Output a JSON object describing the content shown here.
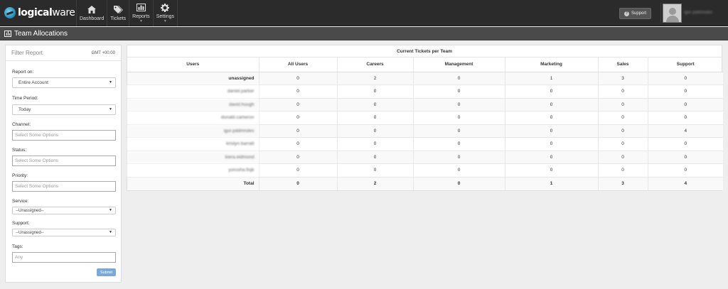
{
  "brand": {
    "logo_bold": "logical",
    "logo_light": "ware"
  },
  "nav": [
    {
      "label": "Dashboard",
      "icon": "home-icon"
    },
    {
      "label": "Tickets",
      "icon": "tags-icon"
    },
    {
      "label": "Reports",
      "icon": "bar-chart-icon",
      "caret": "▼"
    },
    {
      "label": "Settings",
      "icon": "gear-icon",
      "caret": "▼"
    }
  ],
  "header": {
    "support_label": "Support",
    "user_name": "Igor pddmndes"
  },
  "page": {
    "title": "Team Allocations"
  },
  "filter": {
    "title": "Filter Report",
    "timezone": "GMT +00:00",
    "report_on_label": "Report on:",
    "report_on_value": "Entire Account",
    "time_period_label": "Time Period:",
    "time_period_value": "Today",
    "channel_label": "Channel:",
    "channel_placeholder": "Select Some Options",
    "status_label": "Status:",
    "status_placeholder": "Select Some Options",
    "priority_label": "Priority:",
    "priority_placeholder": "Select Some Options",
    "service_label": "Service:",
    "service_value": "--Unassigned--",
    "support_label": "Support:",
    "support_value": "--Unassigned--",
    "tags_label": "Tags:",
    "tags_placeholder": "Any",
    "submit_label": "Submit"
  },
  "report": {
    "title": "Current Tickets per Team",
    "columns": [
      "Users",
      "All Users",
      "Careers",
      "Management",
      "Marketing",
      "Sales",
      "Support"
    ],
    "rows": [
      {
        "user": "unassigned",
        "values": [
          "0",
          "2",
          "0",
          "1",
          "3",
          "0"
        ]
      },
      {
        "user": "daniel.parker",
        "values": [
          "0",
          "0",
          "0",
          "0",
          "0",
          "0"
        ]
      },
      {
        "user": "david.hough",
        "values": [
          "0",
          "0",
          "0",
          "0",
          "0",
          "0"
        ]
      },
      {
        "user": "donald.cameron",
        "values": [
          "0",
          "0",
          "0",
          "0",
          "0",
          "0"
        ]
      },
      {
        "user": "igor.pddmndes",
        "values": [
          "0",
          "0",
          "0",
          "0",
          "0",
          "4"
        ]
      },
      {
        "user": "kristyn.barratt",
        "values": [
          "0",
          "0",
          "0",
          "0",
          "0",
          "0"
        ]
      },
      {
        "user": "kiera.eidmond",
        "values": [
          "0",
          "0",
          "0",
          "0",
          "0",
          "0"
        ]
      },
      {
        "user": "yorusha.fisjk",
        "values": [
          "0",
          "0",
          "0",
          "0",
          "0",
          "0"
        ]
      }
    ],
    "total": {
      "label": "Total",
      "values": [
        "0",
        "2",
        "0",
        "1",
        "3",
        "4"
      ]
    }
  }
}
